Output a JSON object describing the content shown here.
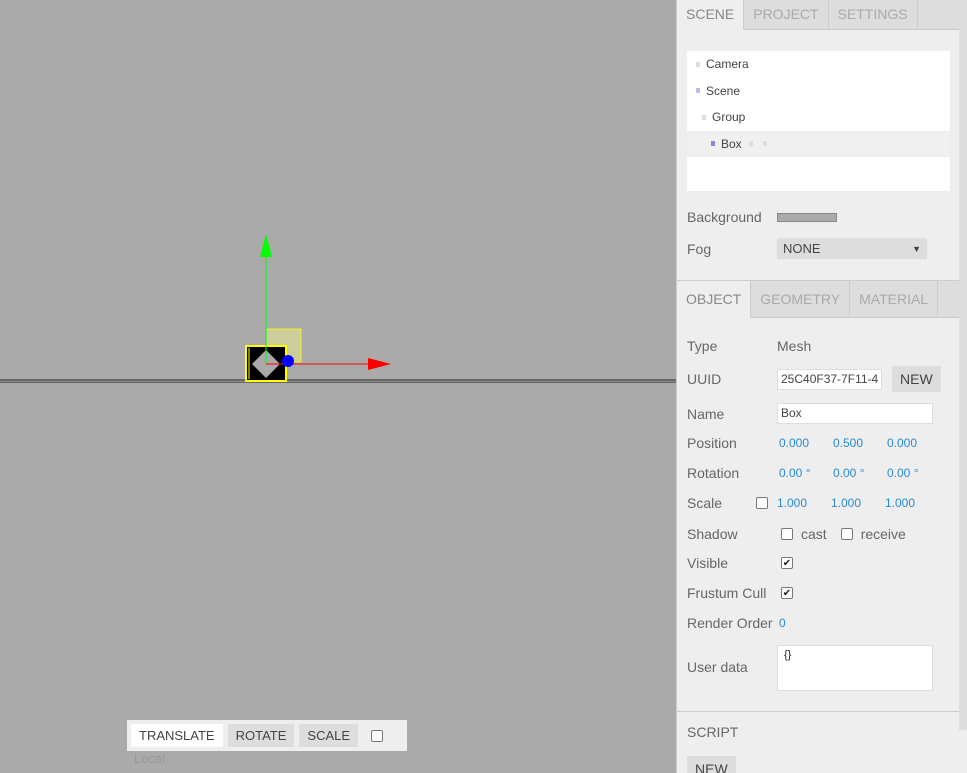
{
  "toolbar": {
    "translate": "TRANSLATE",
    "rotate": "ROTATE",
    "scale": "SCALE",
    "local": "Local"
  },
  "sidebar": {
    "tabs": [
      "SCENE",
      "PROJECT",
      "SETTINGS"
    ],
    "outliner": [
      "Camera",
      "Scene",
      "Group",
      "Box"
    ],
    "background_label": "Background",
    "background_color": "#aaaaaa",
    "fog_label": "Fog",
    "fog_value": "NONE",
    "object_tabs": [
      "OBJECT",
      "GEOMETRY",
      "MATERIAL"
    ],
    "object": {
      "type_label": "Type",
      "type_value": "Mesh",
      "uuid_label": "UUID",
      "uuid_value": "25C40F37-7F11-4",
      "new_label": "NEW",
      "name_label": "Name",
      "name_value": "Box",
      "position_label": "Position",
      "position": [
        "0.000",
        "0.500",
        "0.000"
      ],
      "rotation_label": "Rotation",
      "rotation": [
        "0.00 °",
        "0.00 °",
        "0.00 °"
      ],
      "scale_label": "Scale",
      "scale": [
        "1.000",
        "1.000",
        "1.000"
      ],
      "shadow_label": "Shadow",
      "cast_label": "cast",
      "receive_label": "receive",
      "visible_label": "Visible",
      "frustum_label": "Frustum Cull",
      "render_order_label": "Render Order",
      "render_order_value": "0",
      "userdata_label": "User data",
      "userdata_value": "{}"
    },
    "script_label": "SCRIPT",
    "script_new": "NEW"
  },
  "colors": {
    "gizmo_x": "#ff0000",
    "gizmo_y": "#00ff00",
    "gizmo_z": "#0000ff",
    "selection": "#ffff00"
  }
}
